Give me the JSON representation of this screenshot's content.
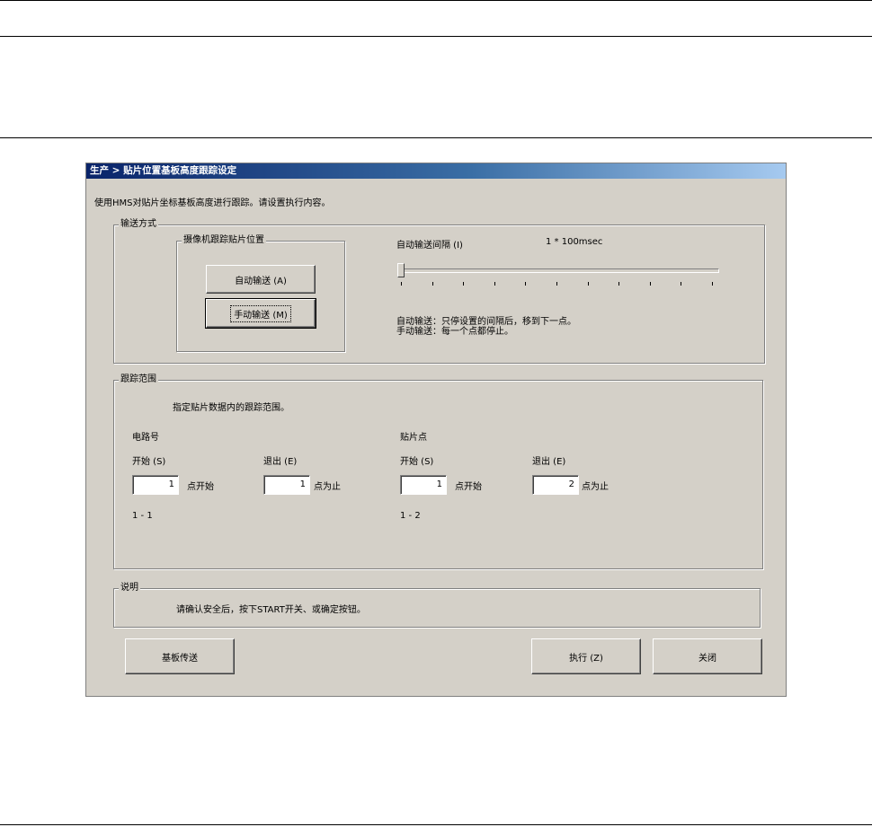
{
  "dialog": {
    "title": "生产 > 贴片位置基板高度跟踪设定",
    "instruction": "使用HMS对贴片坐标基板高度进行跟踪。请设置执行内容。"
  },
  "transport": {
    "group_label": "输送方式",
    "camera_group_label": "摄像机跟踪贴片位置",
    "auto_button": "自动输送 (A)",
    "manual_button": "手动输送 (M)",
    "interval_label": "自动输送间隔 (I)",
    "interval_value": "1 * 100msec",
    "slider_position": 0,
    "slider_ticks": 11,
    "desc_auto": "自动输送：只停设置的间隔后，移到下一点。",
    "desc_manual": "手动输送：每一个点都停止。"
  },
  "range": {
    "group_label": "跟踪范围",
    "description": "指定贴片数据内的跟踪范围。",
    "circuit": {
      "label": "电路号",
      "start_label": "开始 (S)",
      "start_value": "1",
      "start_suffix": "点开始",
      "end_label": "退出 (E)",
      "end_value": "1",
      "end_suffix": "点为止",
      "range_text": "1 - 1"
    },
    "point": {
      "label": "贴片点",
      "start_label": "开始 (S)",
      "start_value": "1",
      "start_suffix": "点开始",
      "end_label": "退出 (E)",
      "end_value": "2",
      "end_suffix": "点为止",
      "range_text": "1 - 2"
    }
  },
  "note": {
    "group_label": "说明",
    "text": "请确认安全后，按下START开关、或确定按钮。"
  },
  "buttons": {
    "board_transfer": "基板传送",
    "execute": "执行 (Z)",
    "close": "关闭"
  }
}
